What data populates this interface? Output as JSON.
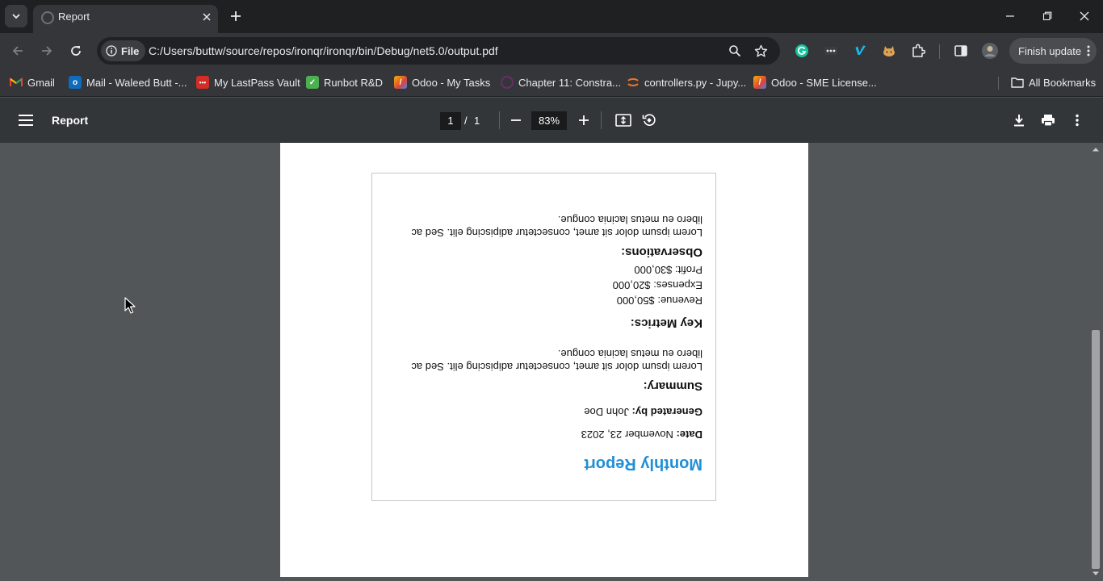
{
  "tab": {
    "title": "Report"
  },
  "toolbar": {
    "chip_label": "File",
    "url": "C:/Users/buttw/source/repos/ironqr/ironqr/bin/Debug/net5.0/output.pdf",
    "finish_update": "Finish update"
  },
  "bookmarks": [
    {
      "label": "Gmail",
      "icon": "gmail-icon",
      "color": "#ea4335"
    },
    {
      "label": "Mail - Waleed Butt -...",
      "icon": "outlook-icon",
      "color": "#0f6cbd"
    },
    {
      "label": "My LastPass Vault",
      "icon": "lastpass-icon",
      "color": "#d32d27"
    },
    {
      "label": "Runbot R&D",
      "icon": "runbot-icon",
      "color": "#4caf50"
    },
    {
      "label": "Odoo - My Tasks",
      "icon": "odoo-icon",
      "color": "#f4b400"
    },
    {
      "label": "Chapter 11: Constra...",
      "icon": "chapter-icon",
      "color": "#6b2b6b"
    },
    {
      "label": "controllers.py - Jupy...",
      "icon": "jupyter-icon",
      "color": "#f37626"
    },
    {
      "label": "Odoo - SME License...",
      "icon": "odoo-icon",
      "color": "#f4b400"
    }
  ],
  "all_bookmarks": "All Bookmarks",
  "pdf": {
    "title": "Report",
    "page_current": "1",
    "page_separator": "/",
    "page_total": "1",
    "zoom": "83%"
  },
  "report": {
    "title": "Monthly Report",
    "date_label": "Date:",
    "date_value": "November 23, 2023",
    "generated_label": "Generated by:",
    "generated_value": "John Doe",
    "summary_heading": "Summary:",
    "summary_text": "Lorem ipsum dolor sit amet, consectetur adipiscing elit. Sed ac libero eu metus lacinia congue.",
    "metrics_heading": "Key Metrics:",
    "revenue": "Revenue: $50,000",
    "expenses": "Expenses: $20,000",
    "profit": "Profit: $30,000",
    "observations_heading": "Observations:",
    "observations_text": "Lorem ipsum dolor sit amet, consectetur adipiscing elit. Sed ac libero eu metus lacinia congue."
  },
  "colors": {
    "accent": "#1f8fd8",
    "viewer_bg": "#525659",
    "toolbar_bg": "#323639"
  }
}
